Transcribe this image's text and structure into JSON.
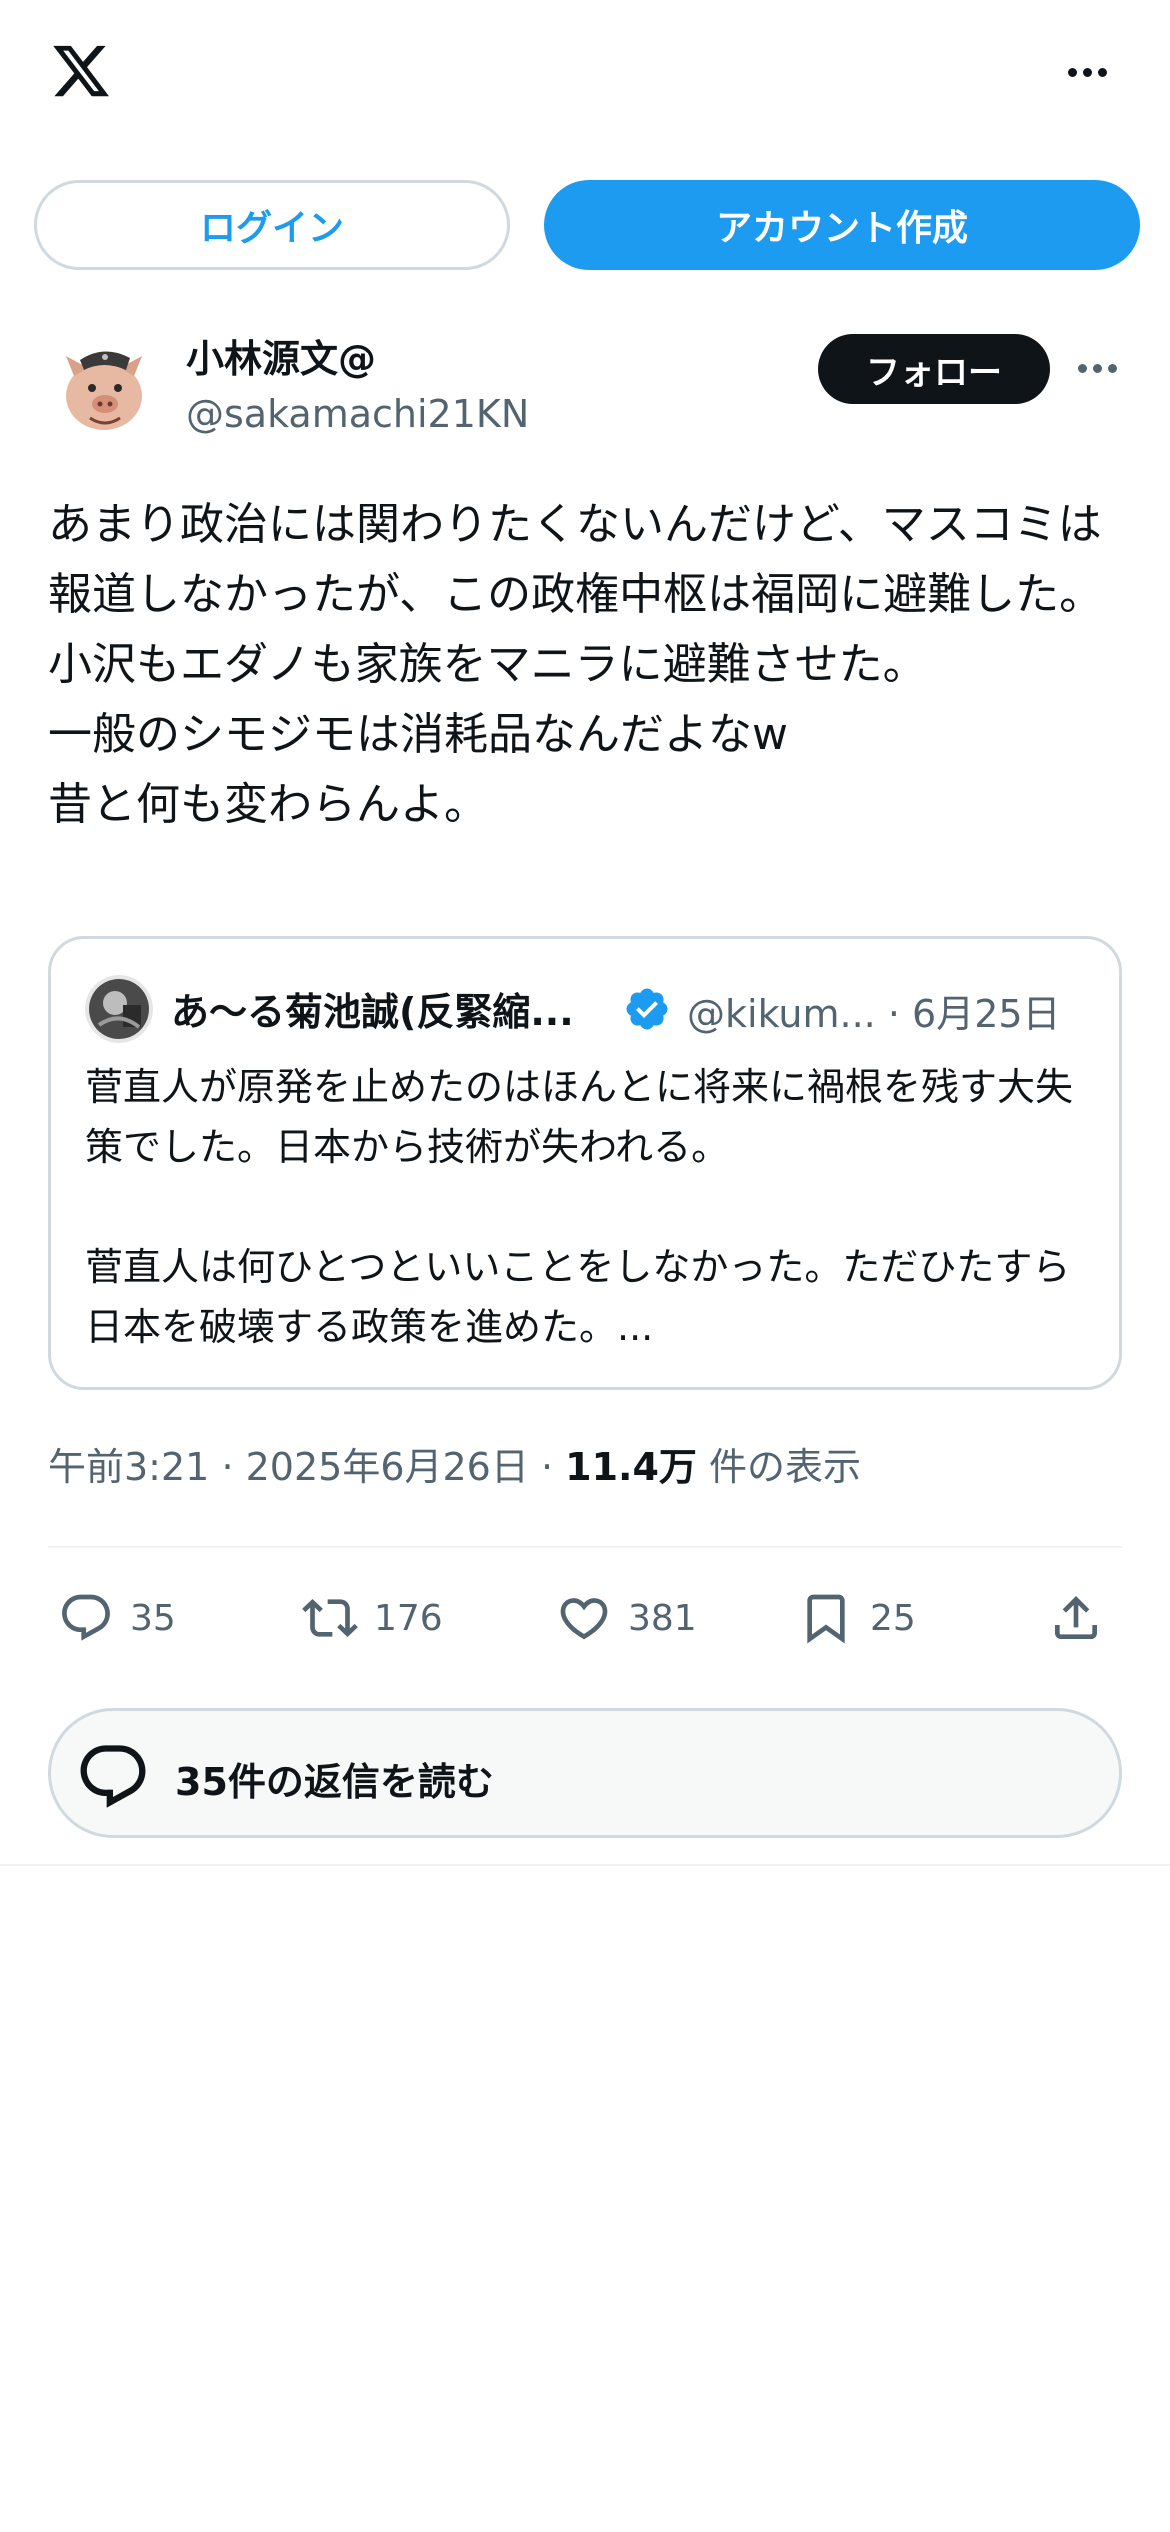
{
  "header": {
    "logo_icon": "x-logo-icon",
    "more_icon": "more-horizontal-icon"
  },
  "auth": {
    "login_label": "ログイン",
    "signup_label": "アカウント作成"
  },
  "author": {
    "name": "小林源文@",
    "handle": "@sakamachi21KN",
    "follow_label": "フォロー"
  },
  "tweet": {
    "text": "あまり政治には関わりたくないんだけど、マスコミは報道しなかったが、この政権中枢は福岡に避難した。小沢もエダノも家族をマニラに避難させた。\n一般のシモジモは消耗品なんだよなw\n昔と何も変わらんよ。"
  },
  "quote": {
    "name": "あ〜る菊池誠(反緊縮...",
    "handle": "@kikum...",
    "separator": "·",
    "date": "6月25日",
    "text": "菅直人が原発を止めたのはほんとに将来に禍根を残す大失策でした。日本から技術が失われる。\n\n菅直人は何ひとつといいことをしなかった。ただひたすら日本を破壊する政策を進めた。..."
  },
  "meta": {
    "time": "午前3:21",
    "sep1": "·",
    "date": "2025年6月26日",
    "sep2": "·",
    "views": "11.4万",
    "views_label": "件の表示"
  },
  "actions": {
    "replies": "35",
    "reposts": "176",
    "likes": "381",
    "bookmarks": "25"
  },
  "read_replies": {
    "label": "35件の返信を読む"
  },
  "colors": {
    "accent": "#1d9bf0",
    "text": "#0f1419",
    "secondary": "#536471",
    "border": "#cfd9de"
  }
}
